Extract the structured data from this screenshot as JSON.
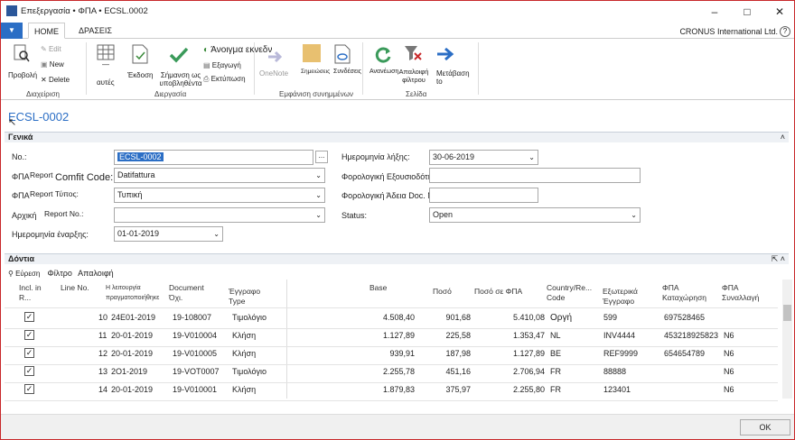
{
  "window": {
    "title": "Επεξεργασία • ΦΠΑ • ECSL.0002",
    "company": "CRONUS International Ltd."
  },
  "tabs": {
    "home": "HOME",
    "actions": "ΔΡΑΣΕΙΣ"
  },
  "ribbon": {
    "edit": "Edit",
    "view": "Προβολή",
    "new": "New",
    "delete": "Delete",
    "manage_group": "Διαχείριση",
    "col1": "αυτές",
    "release": "Έκδοση",
    "mark_submitted": "Σήμανση ως υποβληθέντα",
    "open_excel": "Άνοιγμα εκνεδν",
    "export": "Εξαγωγή",
    "print": "Εκτύπωση",
    "process_group": "Διεργασία",
    "onenote": "OneNote",
    "notes": "Σημειώσεις",
    "links": "Συνδέσεις",
    "attached_group": "Εμφάνιση συνημμένων",
    "refresh": "Ανανέωση",
    "clear_filter": "Απαλοιφή φίλτρου",
    "goto": "Μετάβαση to",
    "page_group": "Σελίδα"
  },
  "page_title": "ECSL-0002",
  "general": {
    "section": "Γενικά",
    "no_label": "No.:",
    "no_value": "ECSL-0002",
    "report_label_a": "ΦΠΑ",
    "report_label_b": "Report",
    "comfit": "Comfit Code:",
    "report_value": "Datifattura",
    "type_label_a": "ΦΠΑ",
    "type_label_b": "Report Τύπος:",
    "type_value": "Τυπική",
    "orig_label_a": "Αρχική",
    "orig_label_b": "Report No.:",
    "orig_value": "",
    "start_label": "Ημερομηνία έναρξης:",
    "start_value": "01-01-2019",
    "end_label": "Ημερομηνία λήξης:",
    "end_value": "30-06-2019",
    "tax_auth_label": "Φορολογική Εξουσιοδότηση.",
    "tax_auth_value": "",
    "tax_doc_label": "Φορολογική Άδεια Doc. No.:",
    "tax_doc_value": "",
    "status_label": "Status:",
    "status_value": "Open"
  },
  "lines": {
    "section": "Δόντια",
    "find": "Εύρεση",
    "filter": "Φίλτρο",
    "clear": "Απαλοιφή",
    "headers": {
      "incl": "Incl. in R...",
      "line_no": "Line No.",
      "op_date": "Η λειτουργία πραγματοποιήθηκε",
      "doc_no": "Document Όχι.",
      "doc_type": "Έγγραφο Type",
      "base": "Base",
      "amount": "Ποσό",
      "vat_amount": "Ποσό σε ΦΠΑ",
      "country": "Country/Re... Code",
      "ext_doc": "Εξωτερικά Έγγραφο",
      "vat_reg": "ΦΠΑ Καταχώρηση",
      "vat_trans": "ΦΠΑ Συναλλαγή"
    },
    "rows": [
      {
        "incl": "✓",
        "line": "10",
        "date": "24E01-2019",
        "doc": "19-108007",
        "type": "Τιμολόγιο",
        "base": "4.508,40",
        "amount": "901,68",
        "vat": "5.410,08",
        "country": "Οργή",
        "ext": "599",
        "reg": "697528465",
        "trans": ""
      },
      {
        "incl": "✓",
        "line": "11",
        "date": "20-01-2019",
        "doc": "19-V010004",
        "type": "Κλήση",
        "base": "1.127,89",
        "amount": "225,58",
        "vat": "1.353,47",
        "country": "NL",
        "ext": "INV4444",
        "reg": "453218925823",
        "trans": "N6"
      },
      {
        "incl": "✓",
        "line": "12",
        "date": "20-01-2019",
        "doc": "19-V010005",
        "type": "Κλήση",
        "base": "939,91",
        "amount": "187,98",
        "vat": "1.127,89",
        "country": "BE",
        "ext": "REF9999",
        "reg": "654654789",
        "trans": "N6"
      },
      {
        "incl": "✓",
        "line": "13",
        "date": "2O1-2019",
        "doc": "19-VOT0007",
        "type": "Τιμολόγιο",
        "base": "2.255,78",
        "amount": "451,16",
        "vat": "2.706,94",
        "country": "FR",
        "ext": "88888",
        "reg": "",
        "trans": "N6"
      },
      {
        "incl": "✓",
        "line": "14",
        "date": "20-01-2019",
        "doc": "19-V010001",
        "type": "Κλήση",
        "base": "1.879,83",
        "amount": "375,97",
        "vat": "2.255,80",
        "country": "FR",
        "ext": "123401",
        "reg": "",
        "trans": "N6"
      }
    ]
  },
  "ok": "OK"
}
